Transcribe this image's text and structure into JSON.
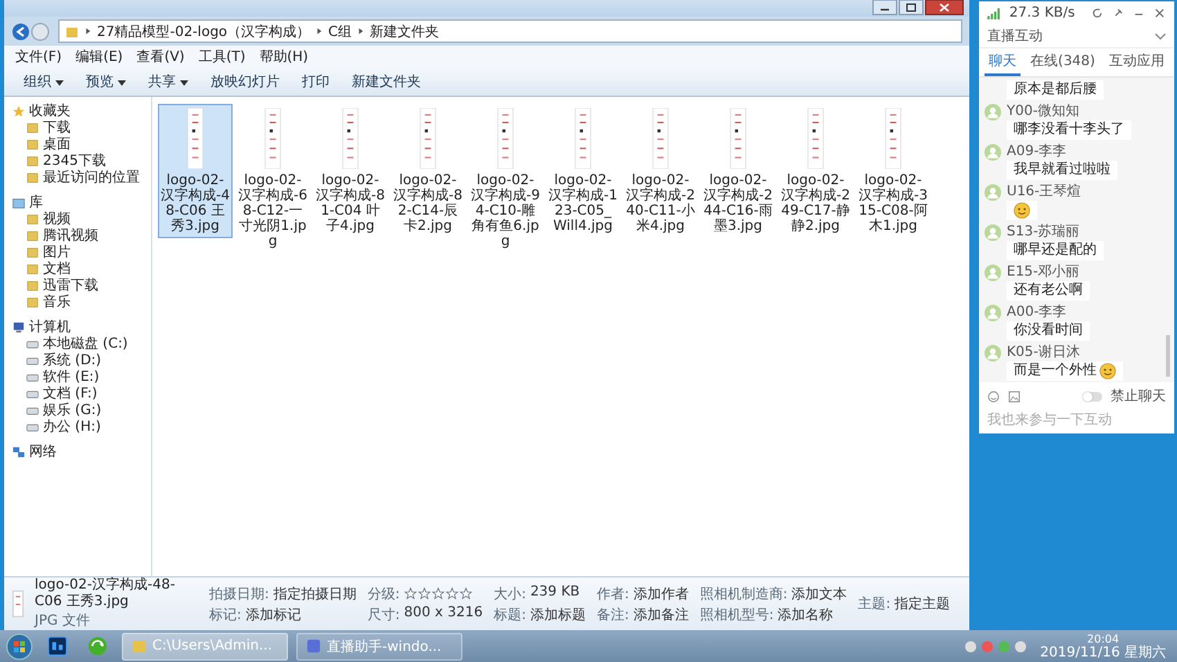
{
  "explorer": {
    "address": [
      "27精品模型-02-logo（汉字构成）",
      "C组",
      "新建文件夹"
    ],
    "menu": [
      "文件(F)",
      "编辑(E)",
      "查看(V)",
      "工具(T)",
      "帮助(H)"
    ],
    "toolbar": [
      {
        "label": "组织",
        "dropdown": true
      },
      {
        "label": "预览",
        "dropdown": true
      },
      {
        "label": "共享",
        "dropdown": true
      },
      {
        "label": "放映幻灯片",
        "dropdown": false
      },
      {
        "label": "打印",
        "dropdown": false
      },
      {
        "label": "新建文件夹",
        "dropdown": false
      }
    ],
    "sidebar": [
      {
        "heading": "收藏夹",
        "items": [
          "下载",
          "桌面",
          "2345下载",
          "最近访问的位置"
        ]
      },
      {
        "heading": "库",
        "items": [
          "视频",
          "腾讯视频",
          "图片",
          "文档",
          "迅雷下载",
          "音乐"
        ]
      },
      {
        "heading": "计算机",
        "items": [
          "本地磁盘 (C:)",
          "系统 (D:)",
          "软件 (E:)",
          "文档 (F:)",
          "娱乐 (G:)",
          "办公 (H:)"
        ]
      },
      {
        "heading": "网络"
      }
    ],
    "files": [
      {
        "name": "logo-02-汉字构成-48-C06 王秀3.jpg",
        "selected": true
      },
      {
        "name": "logo-02-汉字构成-68-C12-一寸光阴1.jpg",
        "selected": false
      },
      {
        "name": "logo-02-汉字构成-81-C04 叶子4.jpg",
        "selected": false
      },
      {
        "name": "logo-02-汉字构成-82-C14-辰卡2.jpg",
        "selected": false
      },
      {
        "name": "logo-02-汉字构成-94-C10-雕角有鱼6.jpg",
        "selected": false
      },
      {
        "name": "logo-02-汉字构成-123-C05_Will4.jpg",
        "selected": false
      },
      {
        "name": "logo-02-汉字构成-240-C11-小米4.jpg",
        "selected": false
      },
      {
        "name": "logo-02-汉字构成-244-C16-雨墨3.jpg",
        "selected": false
      },
      {
        "name": "logo-02-汉字构成-249-C17-静静2.jpg",
        "selected": false
      },
      {
        "name": "logo-02-汉字构成-315-C08-阿木1.jpg",
        "selected": false
      }
    ],
    "details": {
      "name": "logo-02-汉字构成-48-C06 王秀3.jpg",
      "type": "JPG 文件",
      "stars": 0,
      "columns": [
        [
          {
            "label": "拍摄日期:",
            "value": "指定拍摄日期"
          },
          {
            "label": "标记:",
            "value": "添加标记"
          }
        ],
        [
          {
            "label": "分级:",
            "kind": "rating"
          },
          {
            "label": "尺寸:",
            "value": "800 x 3216"
          }
        ],
        [
          {
            "label": "大小:",
            "value": "239 KB"
          },
          {
            "label": "标题:",
            "value": "添加标题"
          }
        ],
        [
          {
            "label": "作者:",
            "value": "添加作者"
          },
          {
            "label": "备注:",
            "value": "添加备注"
          }
        ],
        [
          {
            "label": "照相机制造商:",
            "value": "添加文本"
          },
          {
            "label": "照相机型号:",
            "value": "添加名称"
          }
        ],
        [
          {
            "label": "主题:",
            "value": "指定主题"
          }
        ]
      ]
    }
  },
  "chat": {
    "speed": "27.3 KB/s",
    "channel": "直播互动",
    "tabs": [
      {
        "label": "聊天",
        "selected": true
      },
      {
        "label": "在线(348)",
        "selected": false
      },
      {
        "label": "互动应用",
        "selected": false
      }
    ],
    "messages": [
      {
        "text": "原本是都后腰",
        "emoji": false
      },
      {
        "sender": "Y00-微知知",
        "text": "哪李没看十李头了",
        "emoji": false
      },
      {
        "sender": "A09-李李",
        "text": "我早就看过啦啦",
        "emoji": false
      },
      {
        "sender": "U16-王琴煊",
        "emoji": true
      },
      {
        "sender": "S13-苏瑞丽",
        "text": "哪早还是配的",
        "emoji": false
      },
      {
        "sender": "E15-邓小丽",
        "text": "还有老公啊",
        "emoji": false
      },
      {
        "sender": "A00-李李",
        "text": "你没看时间",
        "emoji": false
      },
      {
        "sender": "K05-谢日沐",
        "text": "而是一个外性",
        "emoji": true
      }
    ],
    "placeholder": "我也来参与一下互动",
    "mute_label": "禁止聊天",
    "mute_on": false
  },
  "taskbar": {
    "windows": [
      {
        "label": "C:\\Users\\Admin...",
        "active": true
      },
      {
        "label": "直播助手-windo...",
        "active": false
      }
    ],
    "time": "20:04",
    "date": "2019/11/16 星期六"
  }
}
